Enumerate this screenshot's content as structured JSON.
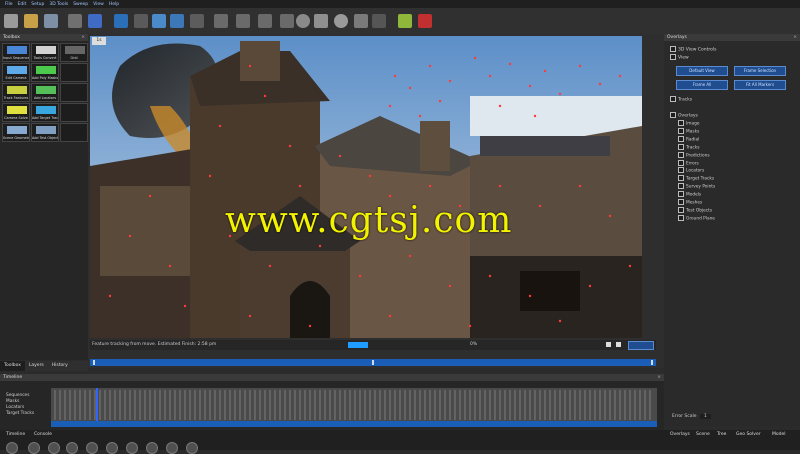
{
  "menu": [
    "File",
    "Edit",
    "Setup",
    "3D Tools",
    "Sweep",
    "View",
    "Help"
  ],
  "toolbox": {
    "title": "Toolbox",
    "tools": [
      {
        "label": "Input Sequence",
        "icon": "film-icon",
        "color": "#4a86d6"
      },
      {
        "label": "Tools Convert",
        "icon": "convert-icon",
        "color": "#d2d2d2"
      },
      {
        "label": "Grid",
        "icon": "grid-icon",
        "color": "#666666"
      },
      {
        "label": "Edit Camera",
        "icon": "camera-icon",
        "color": "#5ea9e8"
      },
      {
        "label": "Add Poly Masks",
        "icon": "mask-icon",
        "color": "#4cc94c"
      },
      {
        "label": "",
        "icon": "blank-icon",
        "color": "#1d1d1d"
      },
      {
        "label": "Track Features",
        "icon": "track-icon",
        "color": "#c8d040"
      },
      {
        "label": "Add Locators",
        "icon": "locator-icon",
        "color": "#55c05a"
      },
      {
        "label": "",
        "icon": "blank-icon",
        "color": "#1d1d1d"
      },
      {
        "label": "Camera Solve",
        "icon": "solve-icon",
        "color": "#e0e040"
      },
      {
        "label": "Add Target Tracks",
        "icon": "target-icon",
        "color": "#3aa6e0"
      },
      {
        "label": "",
        "icon": "blank-icon",
        "color": "#1d1d1d"
      },
      {
        "label": "Scene Geometry",
        "icon": "geometry-icon",
        "color": "#88aad0"
      },
      {
        "label": "Add Test Objects",
        "icon": "objects-icon",
        "color": "#7fa0c0"
      },
      {
        "label": "",
        "icon": "blank-icon",
        "color": "#1d1d1d"
      }
    ]
  },
  "left_tabs": [
    "Toolbox",
    "Layers",
    "History"
  ],
  "viewport": {
    "label": "1s",
    "status": "Feature tracking from move. Estimated Finish: 2:58 pm",
    "progress": 0.15,
    "percent": "0%",
    "watermark": "www.cgtsj.com"
  },
  "overlays": {
    "title": "Overlays",
    "view_controls": "3D View Controls",
    "view_label": "View",
    "buttons": [
      "Default View",
      "Frame Selection",
      "Frame All",
      "Fit All Markers"
    ],
    "tracks": "Tracks",
    "overlays_label": "Overlays",
    "tree": [
      "Image",
      "Masks",
      "Radial",
      "Tracks",
      "Predictions",
      "Errors",
      "Locators",
      "Target Tracks",
      "Survey Points",
      "Models",
      "Meshes",
      "Test Objects",
      "Ground Plane"
    ]
  },
  "timeline": {
    "title": "Timeline",
    "tree": [
      "Sequences",
      "Masks",
      "Locators",
      "Target Tracks"
    ],
    "cursor_frame": 0.075
  },
  "error_scale": "Error Scale",
  "error_scale_value": "1",
  "bottom_left_tabs": [
    "Timeline",
    "Console"
  ],
  "bottom_right_tabs": [
    "Overlays",
    "Scene",
    "Tree",
    "Geo Solver",
    "Model"
  ]
}
